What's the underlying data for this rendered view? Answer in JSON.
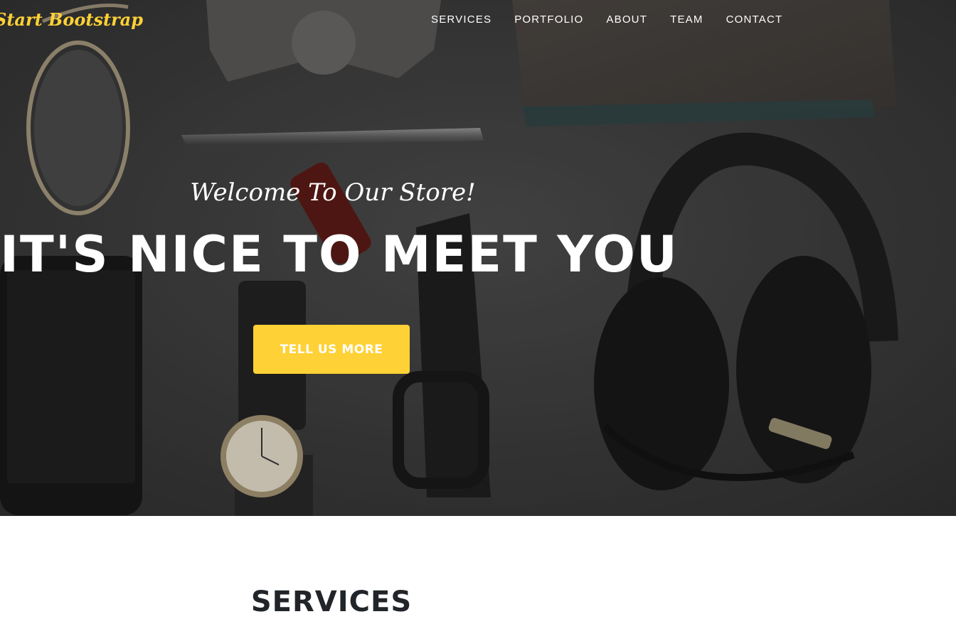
{
  "nav": {
    "brand": "Start Bootstrap",
    "items": [
      {
        "label": "SERVICES"
      },
      {
        "label": "PORTFOLIO"
      },
      {
        "label": "ABOUT"
      },
      {
        "label": "TEAM"
      },
      {
        "label": "CONTACT"
      }
    ]
  },
  "hero": {
    "welcome": "Welcome To Our Store!",
    "heading": "IT'S NICE TO MEET YOU",
    "cta_label": "TELL US MORE"
  },
  "services": {
    "heading": "SERVICES"
  },
  "colors": {
    "accent": "#fed136",
    "dark_text": "#212529",
    "hero_bg": "#3a3a3a"
  }
}
